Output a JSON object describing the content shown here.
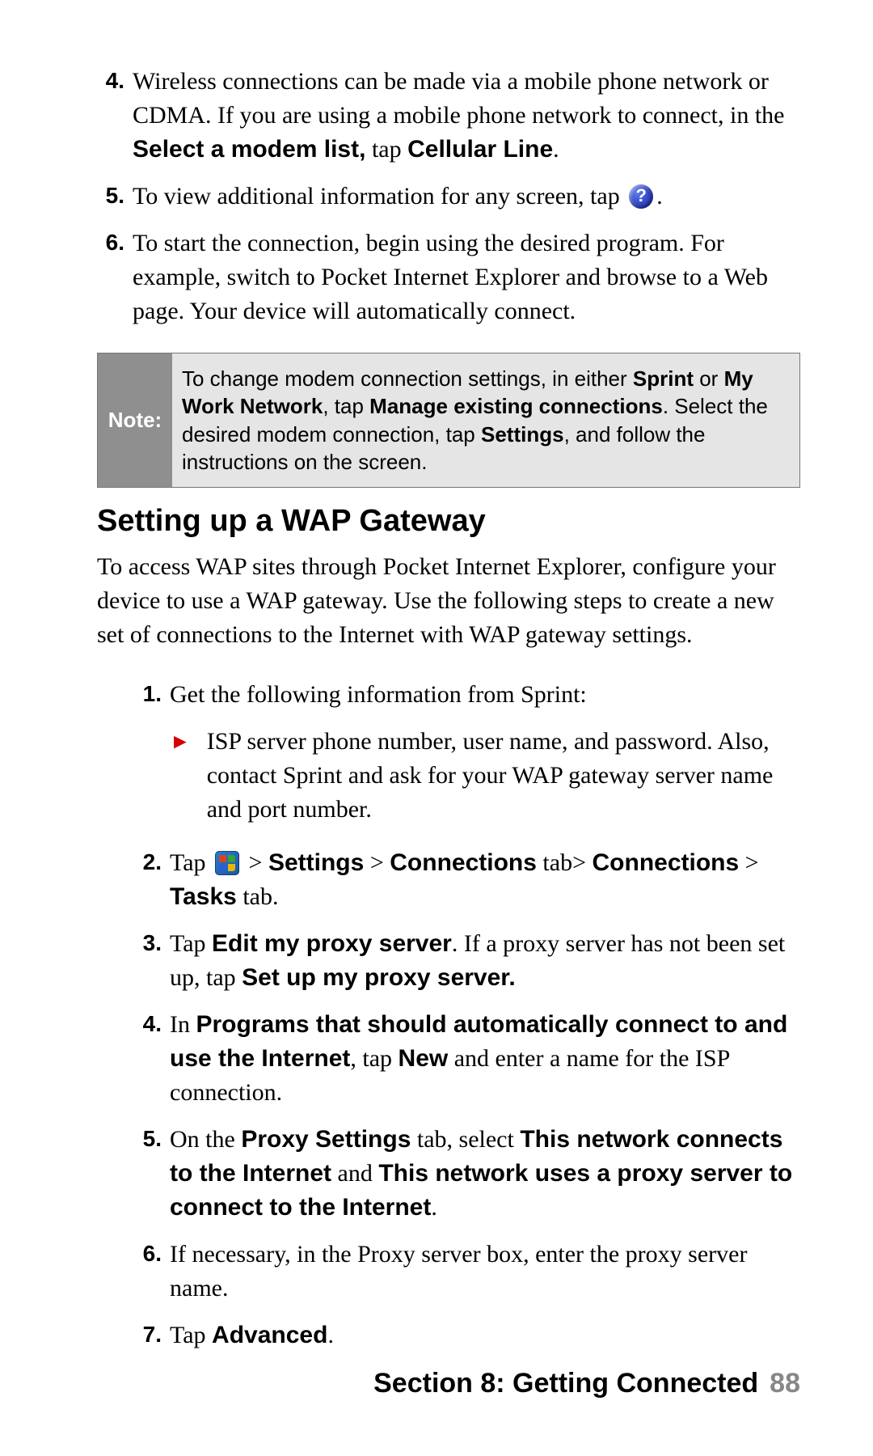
{
  "top_list": {
    "item4": {
      "n": "4.",
      "pre": " Wireless connections can be made via a mobile phone network or CDMA. If you are using a mobile phone network to connect, in the ",
      "bold1": "Select a modem list,",
      "mid": " tap ",
      "bold2": "Cellular Line",
      "post": "."
    },
    "item5": {
      "n": "5.",
      "pre": "To view additional information for any screen, tap ",
      "post": "."
    },
    "item6": {
      "n": "6.",
      "text": "To start the connection, begin using the desired program. For example, switch to Pocket Internet Explorer and browse to a  Web page.  Your device will automatically connect."
    }
  },
  "note": {
    "label": "Note:",
    "pre": "To change modem connection settings, in either ",
    "b1": "Sprint",
    "m1": " or ",
    "b2": "My Work Network",
    "m2": ", tap ",
    "b3": "Manage existing connections",
    "m3": ". Select the desired modem connection, tap ",
    "b4": "Settings",
    "m4": ", and follow the instructions on the screen."
  },
  "section_title": "Setting up a WAP Gateway",
  "lead": "To access WAP sites through Pocket Internet Explorer, configure your device to use a WAP gateway. Use the following steps to create a new set of connections to the Internet with WAP gateway settings.",
  "sub_list": {
    "i1": {
      "n": "1.",
      "text": "Get the following information from Sprint:"
    },
    "bullet1": "ISP server phone number, user name, and password. Also, contact Sprint and ask for your WAP gateway server name and port number.",
    "i2": {
      "n": "2.",
      "pre": "Tap ",
      "post_gt": " > ",
      "b1": "Settings",
      "gt1": " > ",
      "b2": "Connections",
      "m1": " tab> ",
      "b3": "Connections",
      "gt2": " > ",
      "b4": "Tasks",
      "m2": " tab."
    },
    "i3": {
      "n": "3.",
      "pre": "Tap ",
      "b1": "Edit my proxy server",
      "m1": ". If a proxy server has not been set up, tap ",
      "b2": "Set up my proxy server."
    },
    "i4": {
      "n": "4.",
      "pre": "In ",
      "b1": "Programs that should automatically connect to and use the Internet",
      "m1": ", tap ",
      "b2": "New",
      "m2": " and enter a name for the ISP connection."
    },
    "i5": {
      "n": "5.",
      "pre": "On the ",
      "b1": "Proxy Settings",
      "m1": " tab, select ",
      "b2": "This network connects to the Internet",
      "m2": " and ",
      "b3": "This network uses a proxy server to connect to the Internet",
      "m3": "."
    },
    "i6": {
      "n": "6.",
      "text": "If necessary, in the Proxy server box, enter the proxy server name."
    },
    "i7": {
      "n": "7.",
      "pre": "Tap ",
      "b1": "Advanced",
      "post": "."
    }
  },
  "footer": {
    "label": "Section 8: Getting Connected",
    "page": "88"
  }
}
